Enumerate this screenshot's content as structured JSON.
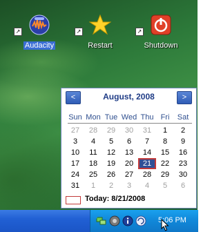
{
  "desktop": {
    "shortcuts": [
      {
        "label": "Audacity",
        "icon": "audacity-icon"
      },
      {
        "label": "Restart",
        "icon": "restart-star-icon"
      },
      {
        "label": "Shutdown",
        "icon": "shutdown-power-icon"
      }
    ]
  },
  "calendar": {
    "title": "August, 2008",
    "prev_label": "<",
    "next_label": ">",
    "weekdays": [
      "Sun",
      "Mon",
      "Tue",
      "Wed",
      "Thu",
      "Fri",
      "Sat"
    ],
    "weeks": [
      [
        "27",
        "28",
        "29",
        "30",
        "31",
        "1",
        "2"
      ],
      [
        "3",
        "4",
        "5",
        "6",
        "7",
        "8",
        "9"
      ],
      [
        "10",
        "11",
        "12",
        "13",
        "14",
        "15",
        "16"
      ],
      [
        "17",
        "18",
        "19",
        "20",
        "21",
        "22",
        "23"
      ],
      [
        "24",
        "25",
        "26",
        "27",
        "28",
        "29",
        "30"
      ],
      [
        "31",
        "1",
        "2",
        "3",
        "4",
        "5",
        "6"
      ]
    ],
    "selected_day": "21",
    "today_label": "Today: 8/21/2008"
  },
  "taskbar": {
    "tray_icons": [
      "network-icon",
      "volume-icon",
      "info-icon",
      "update-icon"
    ],
    "clock": "5:06 PM"
  },
  "colors": {
    "header_text": "#1f3c86",
    "selected_fill": "#2f4f96",
    "today_border": "#c23a3a",
    "taskbar_blue": "#2160d4",
    "tray_blue": "#1189da"
  }
}
